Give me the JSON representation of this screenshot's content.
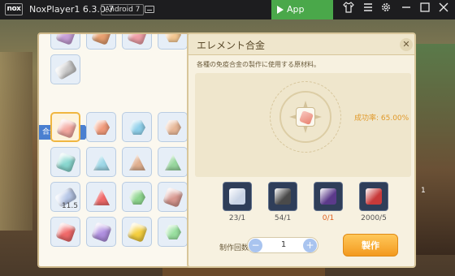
{
  "titlebar": {
    "logo_text": "nox",
    "title": "NoxPlayer1 6.3.0.7",
    "android_badge": "Android 7",
    "app_center_label": "App Center",
    "icons": [
      "keyboard-icon",
      "shirt-icon",
      "menu-icon",
      "gear-icon",
      "minimize-icon",
      "maximize-icon",
      "close-icon"
    ]
  },
  "left_panel": {
    "section_label": "合金製作",
    "top_items": [
      {
        "color": "#c8a0d8",
        "shape": "round"
      },
      {
        "color": "#e8a070",
        "shape": "round"
      },
      {
        "color": "#f0a0a8",
        "shape": "round"
      },
      {
        "color": "#f3c792",
        "shape": "hex"
      },
      {
        "color": "#c8c8c8",
        "shape": "flat"
      }
    ],
    "grid_items": [
      {
        "color": "#f3a8a0",
        "shape": "round",
        "selected": true
      },
      {
        "color": "#f09a7a",
        "shape": "hex"
      },
      {
        "color": "#8fd0ea",
        "shape": "hex"
      },
      {
        "color": "#e8b898",
        "shape": "hex"
      },
      {
        "color": "#8ad8d0",
        "shape": "round"
      },
      {
        "color": "#9fd8e8",
        "shape": "tri"
      },
      {
        "color": "#e0b090",
        "shape": "tri"
      },
      {
        "color": "#9ad8a0",
        "shape": "tri"
      },
      {
        "color": "#b8c8e8",
        "shape": "flat",
        "count": "11.5"
      },
      {
        "color": "#f06a6a",
        "shape": "tri"
      },
      {
        "color": "#8ed58e",
        "shape": "hex"
      },
      {
        "color": "#d89890",
        "shape": "round"
      },
      {
        "color": "#f06a6a",
        "shape": "round"
      },
      {
        "color": "#b090e0",
        "shape": "round"
      },
      {
        "color": "#f5d040",
        "shape": "round"
      },
      {
        "color": "#9ae0a0",
        "shape": "hex"
      }
    ]
  },
  "main_panel": {
    "title": "エレメント合金",
    "close_glyph": "✕",
    "description": "各種の免疫合金の製作に使用する原材料。",
    "success_rate": "成功率: 65.00%",
    "materials": [
      {
        "name": "crystal-shard",
        "color": "#c9d4e6",
        "count": "23/1",
        "count_color": "#555555"
      },
      {
        "name": "ore-chunk",
        "color": "#4a4a4a",
        "count": "54/1",
        "count_color": "#555555"
      },
      {
        "name": "dark-gem",
        "color": "#5b3a8a",
        "count": "0/1",
        "count_color": "#e06020"
      },
      {
        "name": "red-cluster",
        "color": "#c83a3a",
        "count": "2000/5",
        "count_color": "#555555"
      }
    ],
    "quantity_label": "制作回数",
    "quantity_value": "1",
    "minus_glyph": "−",
    "plus_glyph": "+",
    "craft_label": "製作"
  },
  "background": {
    "corner_number": "1"
  }
}
